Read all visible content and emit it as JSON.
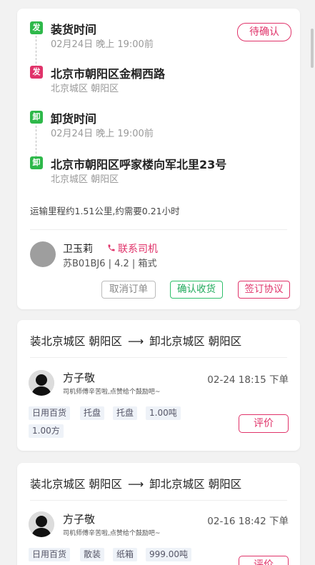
{
  "order_detail": {
    "status": "待确认",
    "stops": [
      {
        "tag": "发",
        "tag_color": "#2eb84a",
        "title": "装货时间",
        "sub": "02月24日 晚上 19:00前"
      },
      {
        "tag": "发",
        "tag_color": "#e0336a",
        "title": "北京市朝阳区金桐西路",
        "sub": "北京城区 朝阳区"
      },
      {
        "tag": "卸",
        "tag_color": "#2eb84a",
        "title": "卸货时间",
        "sub": "02月24日 晚上 19:00前"
      },
      {
        "tag": "卸",
        "tag_color": "#2eb84a",
        "title": "北京市朝阳区呼家楼向军北里23号",
        "sub": "北京城区 朝阳区"
      }
    ],
    "mileage": "运输里程约1.51公里,约需要0.21小时",
    "driver": {
      "name": "卫玉莉",
      "contact_label": "联系司机",
      "vehicle": "苏B01BJ6 | 4.2 | 箱式"
    },
    "actions": {
      "cancel": "取消订单",
      "confirm": "确认收货",
      "sign": "签订协议"
    }
  },
  "orders": [
    {
      "from": "装北京城区 朝阳区",
      "to": "卸北京城区 朝阳区",
      "person": "方子敬",
      "note": "司机师傅辛苦啦,点赞给个鼓励吧~",
      "time": "02-24 18:15 下单",
      "tags": [
        "日用百货",
        "托盘",
        "托盘",
        "1.00吨",
        "1.00方"
      ],
      "rate_label": "评价"
    },
    {
      "from": "装北京城区 朝阳区",
      "to": "卸北京城区 朝阳区",
      "person": "方子敬",
      "note": "司机师傅辛苦啦,点赞给个鼓励吧~",
      "time": "02-16 18:42 下单",
      "tags": [
        "日用百货",
        "散装",
        "纸箱",
        "999.00吨"
      ],
      "rate_label": "评价"
    }
  ],
  "arrow": "⟶",
  "colors": {
    "accent": "#e0336a",
    "green": "#2ebf6a"
  },
  "icons": {
    "phone": "phone-icon",
    "avatar": "avatar-placeholder-icon",
    "person": "person-silhouette-icon"
  }
}
